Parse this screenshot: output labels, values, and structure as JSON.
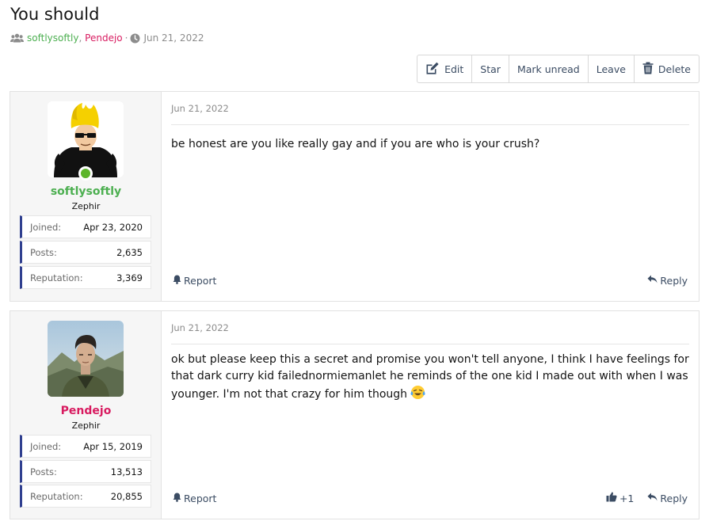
{
  "thread": {
    "title": "You should",
    "participants": [
      "softlysoftly",
      "Pendejo"
    ],
    "comma": ",",
    "separator": "·",
    "date": "Jun 21, 2022"
  },
  "toolbar": {
    "edit": "Edit",
    "star": "Star",
    "mark_unread": "Mark unread",
    "leave": "Leave",
    "delete": "Delete"
  },
  "stats_labels": {
    "joined": "Joined:",
    "posts": "Posts:",
    "reputation": "Reputation:"
  },
  "posts": [
    {
      "author": "softlysoftly",
      "author_color": "#4caf50",
      "user_title": "Zephir",
      "online": true,
      "joined": "Apr 23, 2020",
      "post_count": "2,635",
      "reputation": "3,369",
      "date": "Jun 21, 2022",
      "message": "be honest are you like really gay and if you are who is your crush?",
      "report": "Report",
      "reply": "Reply"
    },
    {
      "author": "Pendejo",
      "author_color": "#d81b60",
      "user_title": "Zephir",
      "online": false,
      "joined": "Apr 15, 2019",
      "post_count": "13,513",
      "reputation": "20,855",
      "date": "Jun 21, 2022",
      "message": "ok but please keep this a secret and promise you won't tell anyone, I think I have feelings for that dark curry kid failednormiemanlet he reminds of the one kid I made out with when I was younger. I'm not that crazy for him though",
      "report": "Report",
      "reaction_count": "+1",
      "reply": "Reply"
    }
  ],
  "icons": {
    "participants": "users-icon",
    "date": "clock-icon",
    "edit": "edit-icon",
    "delete": "trash-icon",
    "report": "bell-icon",
    "reply": "reply-icon",
    "reaction": "thumbs-up-icon",
    "emoji": "crying-laughing-emoji"
  }
}
